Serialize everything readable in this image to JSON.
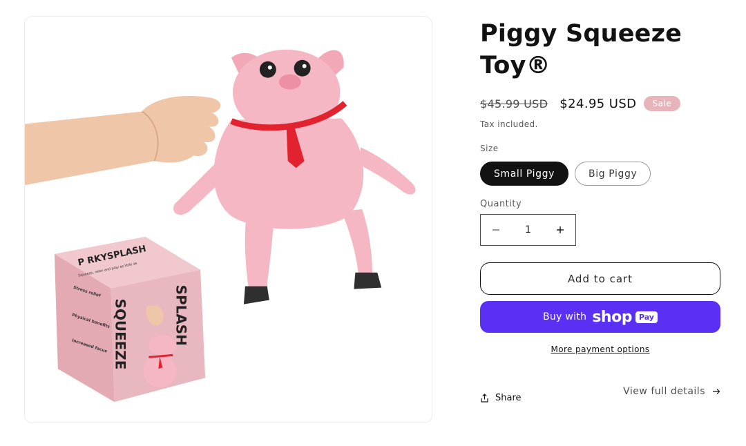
{
  "product": {
    "title": "Piggy Squeeze Toy®",
    "price_compare": "$45.99 USD",
    "price_sale": "$24.95 USD",
    "badge": "Sale",
    "tax_note": "Tax included.",
    "size_label": "Size",
    "sizes": [
      "Small Piggy",
      "Big Piggy"
    ],
    "selected_size": "Small Piggy",
    "quantity_label": "Quantity",
    "quantity": "1",
    "add_to_cart": "Add to cart",
    "buy_with": "Buy with",
    "shop_word": "shop",
    "pay_word": "Pay",
    "more_payment": "More payment options",
    "share": "Share",
    "view_full": "View full details"
  },
  "image": {
    "box_brand": "P  RKYSPLASH",
    "box_text_squeeze": "SQUEEZE",
    "box_text_splash": "SPLASH",
    "box_tagline": "Squeeze, relax and play as little as",
    "box_features": [
      "Stress relief",
      "Physical benefits",
      "Increased focus"
    ]
  },
  "colors": {
    "accent_shop_pay": "#5a31f4",
    "sale_badge": "#e8b4bc",
    "pig_pink": "#f4b7c3",
    "box_pink": "#e9b7bf"
  },
  "icons": {
    "minus": "minus-icon",
    "plus": "plus-icon",
    "share": "share-icon",
    "arrow": "arrow-right-icon"
  }
}
